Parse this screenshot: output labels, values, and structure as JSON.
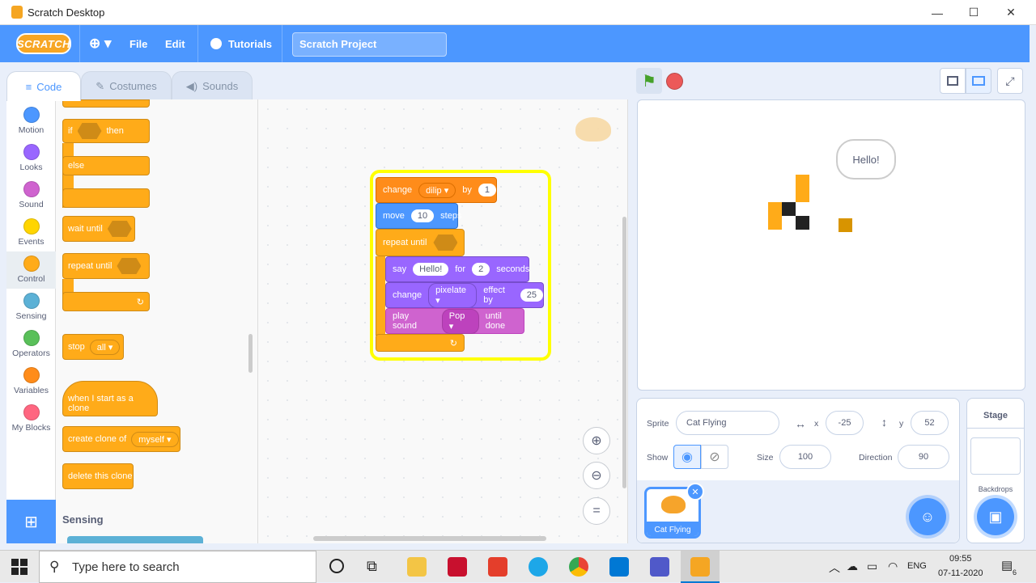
{
  "window": {
    "title": "Scratch Desktop",
    "minimize": "—",
    "maximize": "☐",
    "close": "✕"
  },
  "menubar": {
    "logo": "SCRATCH",
    "globe": "⊕ ▾",
    "file": "File",
    "edit": "Edit",
    "tutorials": "Tutorials",
    "project_title": "Scratch Project"
  },
  "tabs": {
    "code": "Code",
    "costumes": "Costumes",
    "sounds": "Sounds"
  },
  "categories": [
    {
      "label": "Motion",
      "color": "#4c97ff"
    },
    {
      "label": "Looks",
      "color": "#9966ff"
    },
    {
      "label": "Sound",
      "color": "#cf63cf"
    },
    {
      "label": "Events",
      "color": "#ffd500"
    },
    {
      "label": "Control",
      "color": "#ffab19"
    },
    {
      "label": "Sensing",
      "color": "#5cb1d6"
    },
    {
      "label": "Operators",
      "color": "#59c059"
    },
    {
      "label": "Variables",
      "color": "#ff8c1a"
    },
    {
      "label": "My Blocks",
      "color": "#ff6680"
    }
  ],
  "palette": {
    "if": "if",
    "then": "then",
    "else": "else",
    "wait_until": "wait until",
    "repeat_until": "repeat until",
    "stop": "stop",
    "stop_option": "all ▾",
    "when_clone": "when I start as a clone",
    "create_clone": "create clone of",
    "clone_option": "myself ▾",
    "delete_clone": "delete this clone",
    "sensing_header": "Sensing"
  },
  "script": {
    "change": "change",
    "var": "dilip ▾",
    "by": "by",
    "by_value": "1",
    "move": "move",
    "steps_value": "10",
    "steps": "steps",
    "repeat_until": "repeat until",
    "say": "say",
    "say_text": "Hello!",
    "for": "for",
    "secs_value": "2",
    "seconds": "seconds",
    "change2": "change",
    "effect": "pixelate ▾",
    "effect_by": "effect by",
    "effect_value": "25",
    "play_sound": "play sound",
    "sound": "Pop ▾",
    "until_done": "until done"
  },
  "stage": {
    "speech": "Hello!"
  },
  "sprite_info": {
    "sprite_label": "Sprite",
    "sprite_name": "Cat Flying",
    "x_label": "x",
    "x_value": "-25",
    "y_label": "y",
    "y_value": "52",
    "show_label": "Show",
    "size_label": "Size",
    "size_value": "100",
    "direction_label": "Direction",
    "direction_value": "90"
  },
  "sprite_list": [
    {
      "name": "Cat Flying"
    }
  ],
  "stage_panel": {
    "title": "Stage",
    "backdrops": "Backdrops"
  },
  "taskbar": {
    "search_placeholder": "Type here to search",
    "lang": "ENG",
    "time": "09:55",
    "date": "07-11-2020",
    "notif_count": "6"
  },
  "colors": {
    "accent": "#4c97ff",
    "control": "#ffab19",
    "motion": "#4c97ff",
    "looks": "#9966ff",
    "sound": "#cf63cf",
    "variables": "#ff8c1a",
    "highlight": "#ffff00"
  }
}
